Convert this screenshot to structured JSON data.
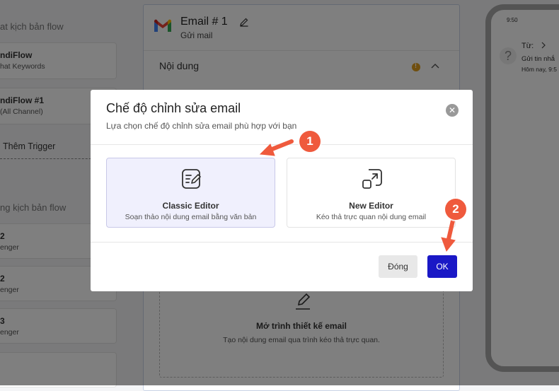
{
  "left_panel": {
    "section1_title": "at kịch bản flow",
    "cards_top": [
      {
        "title": "ndiFlow",
        "subtitle": "hat Keywords"
      },
      {
        "title": "ndiFlow #1",
        "subtitle": "(All Channel)"
      }
    ],
    "trigger_label": "Thêm Trigger",
    "section2_title": "ng kịch bản flow",
    "cards_bottom": [
      {
        "title": "2",
        "subtitle": "enger"
      },
      {
        "title": "2",
        "subtitle": "enger"
      },
      {
        "title": "3",
        "subtitle": "enger"
      },
      {
        "title": "",
        "subtitle": ""
      }
    ]
  },
  "email_panel": {
    "title": "Email # 1",
    "subtitle": "Gửi mail",
    "section_title": "Nội dung",
    "designer_title": "Mở trình thiết kế email",
    "designer_subtitle": "Tạo nội dung email qua trình kéo thả trực quan."
  },
  "phone_preview": {
    "time": "9:50",
    "from": "Từ:",
    "line2": "Gửi tin nhắ",
    "line3": "Hôm nay, 9:5"
  },
  "modal": {
    "title": "Chế độ chỉnh sửa email",
    "subtitle": "Lựa chọn chế độ chỉnh sửa email phù hợp với bạn",
    "options": [
      {
        "title": "Classic Editor",
        "subtitle": "Soạn thảo nội dung email bằng văn bản",
        "selected": true,
        "icon": "text-edit-icon"
      },
      {
        "title": "New Editor",
        "subtitle": "Kéo thả trực quan nội dung email",
        "selected": false,
        "icon": "drag-drop-icon"
      }
    ],
    "close_button": "Đóng",
    "ok_button": "OK"
  },
  "annotations": {
    "step1": "1",
    "step2": "2",
    "color": "#ef5a3d"
  },
  "colors": {
    "primary_button": "#1a18c6",
    "selected_option_bg": "#f0f0fd",
    "warning": "#e09f1f"
  }
}
